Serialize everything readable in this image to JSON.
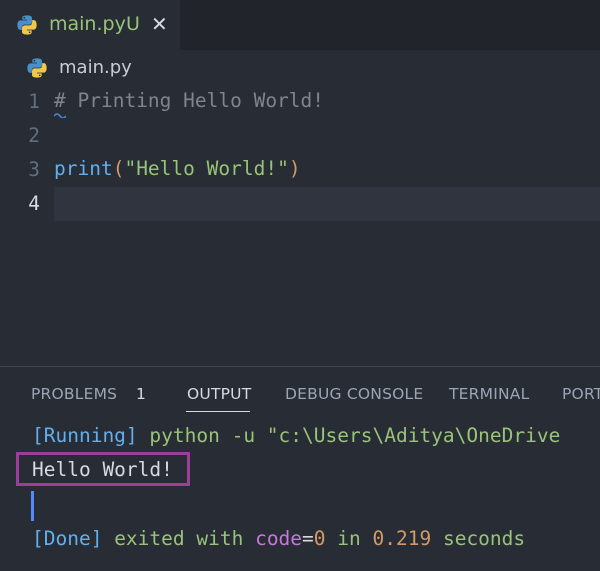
{
  "tab": {
    "filename": "main.py",
    "status": "U",
    "close_glyph": "✕"
  },
  "breadcrumb": {
    "filename": "main.py"
  },
  "editor": {
    "lines": [
      {
        "number": "1",
        "text": "# Printing Hello World!"
      },
      {
        "number": "2",
        "text": ""
      },
      {
        "number": "3",
        "fn": "print",
        "open": "(",
        "string": "\"Hello World!\"",
        "close": ")"
      },
      {
        "number": "4",
        "text": ""
      }
    ]
  },
  "panel": {
    "tabs": [
      "PROBLEMS",
      "OUTPUT",
      "DEBUG CONSOLE",
      "TERMINAL",
      "PORT"
    ],
    "problems_count": "1",
    "active_tab": "OUTPUT",
    "output": {
      "running_tag": "[Running]",
      "running_cmd": " python -u \"c:\\Users\\Aditya\\OneDrive",
      "hello": "Hello World!",
      "done_tag": "[Done]",
      "done_exited": " exited with ",
      "done_code": "code",
      "done_eq": "=",
      "done_zero": "0",
      "done_in": " in ",
      "done_time": "0.219",
      "done_seconds": " seconds"
    }
  },
  "colors": {
    "background": "#282c34",
    "highlight_box": "#9b3f9a",
    "accent_blue": "#61afef",
    "string_green": "#98c379"
  },
  "icons": {
    "file_type": "python-icon",
    "close": "close-icon"
  }
}
